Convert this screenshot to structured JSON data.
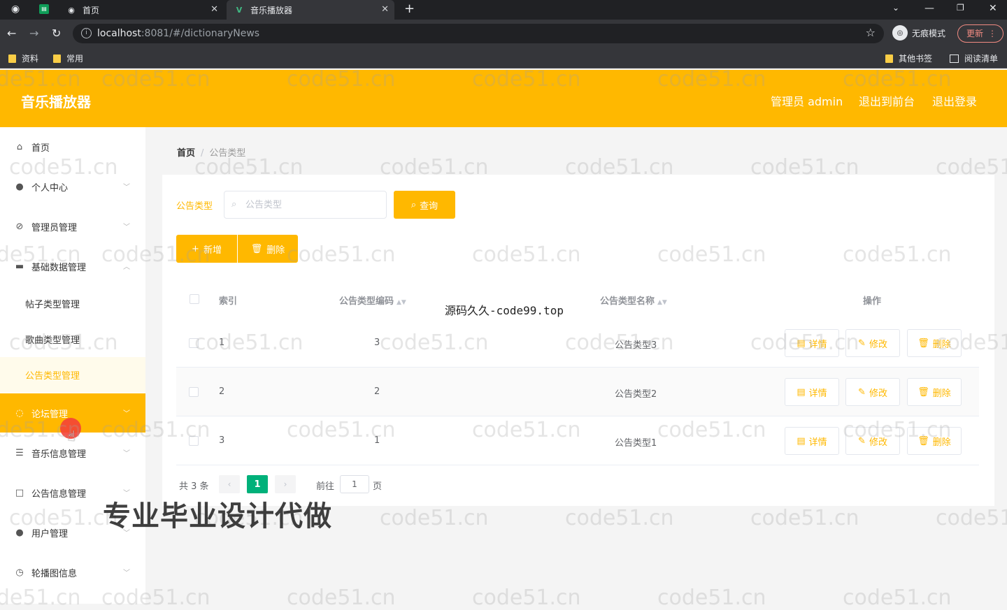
{
  "browser": {
    "tabs": [
      {
        "label": "首页"
      },
      {
        "label": "音乐播放器"
      }
    ],
    "url_host": "localhost",
    "url_rest": ":8081/#/dictionaryNews",
    "incognito_label": "无痕模式",
    "update_label": "更新",
    "bookmarks": [
      "资料",
      "常用"
    ],
    "bookmarks_right": [
      "其他书签",
      "阅读清单"
    ]
  },
  "header": {
    "title": "音乐播放器",
    "user_label": "管理员 admin",
    "front_link": "退出到前台",
    "logout_link": "退出登录"
  },
  "sidebar": {
    "items": [
      {
        "label": "首页",
        "icon": "home-icon"
      },
      {
        "label": "个人中心",
        "icon": "user-icon"
      },
      {
        "label": "管理员管理",
        "icon": "admin-icon"
      },
      {
        "label": "基础数据管理",
        "icon": "data-icon"
      },
      {
        "label": "帖子类型管理",
        "sub": true
      },
      {
        "label": "歌曲类型管理",
        "sub": true
      },
      {
        "label": "公告类型管理",
        "sub": true,
        "selected": true
      },
      {
        "label": "论坛管理",
        "icon": "forum-icon",
        "hover": true
      },
      {
        "label": "音乐信息管理",
        "icon": "music-icon"
      },
      {
        "label": "公告信息管理",
        "icon": "notice-icon"
      },
      {
        "label": "用户管理",
        "icon": "users-icon"
      },
      {
        "label": "轮播图信息",
        "icon": "carousel-icon"
      }
    ]
  },
  "breadcrumb": {
    "home": "首页",
    "current": "公告类型"
  },
  "search": {
    "label": "公告类型",
    "placeholder": "公告类型",
    "query_button": "查询"
  },
  "actions": {
    "add": "新增",
    "delete": "删除"
  },
  "table": {
    "headers": {
      "index": "索引",
      "code": "公告类型编码",
      "name": "公告类型名称",
      "ops": "操作"
    },
    "rows": [
      {
        "index": "1",
        "code": "3",
        "name": "公告类型3"
      },
      {
        "index": "2",
        "code": "2",
        "name": "公告类型2"
      },
      {
        "index": "3",
        "code": "1",
        "name": "公告类型1"
      }
    ],
    "op_labels": {
      "detail": "详情",
      "edit": "修改",
      "delete": "删除"
    }
  },
  "pagination": {
    "total_text": "共 3 条",
    "current_page": "1",
    "goto_label": "前往",
    "goto_value": "1",
    "page_suffix": "页"
  },
  "watermark": {
    "text": "code51.cn",
    "center_text": "源码久久-code99.top",
    "big_text": "专业毕业设计代做"
  },
  "colors": {
    "accent": "#ffb800",
    "page_active": "#00b17a"
  }
}
